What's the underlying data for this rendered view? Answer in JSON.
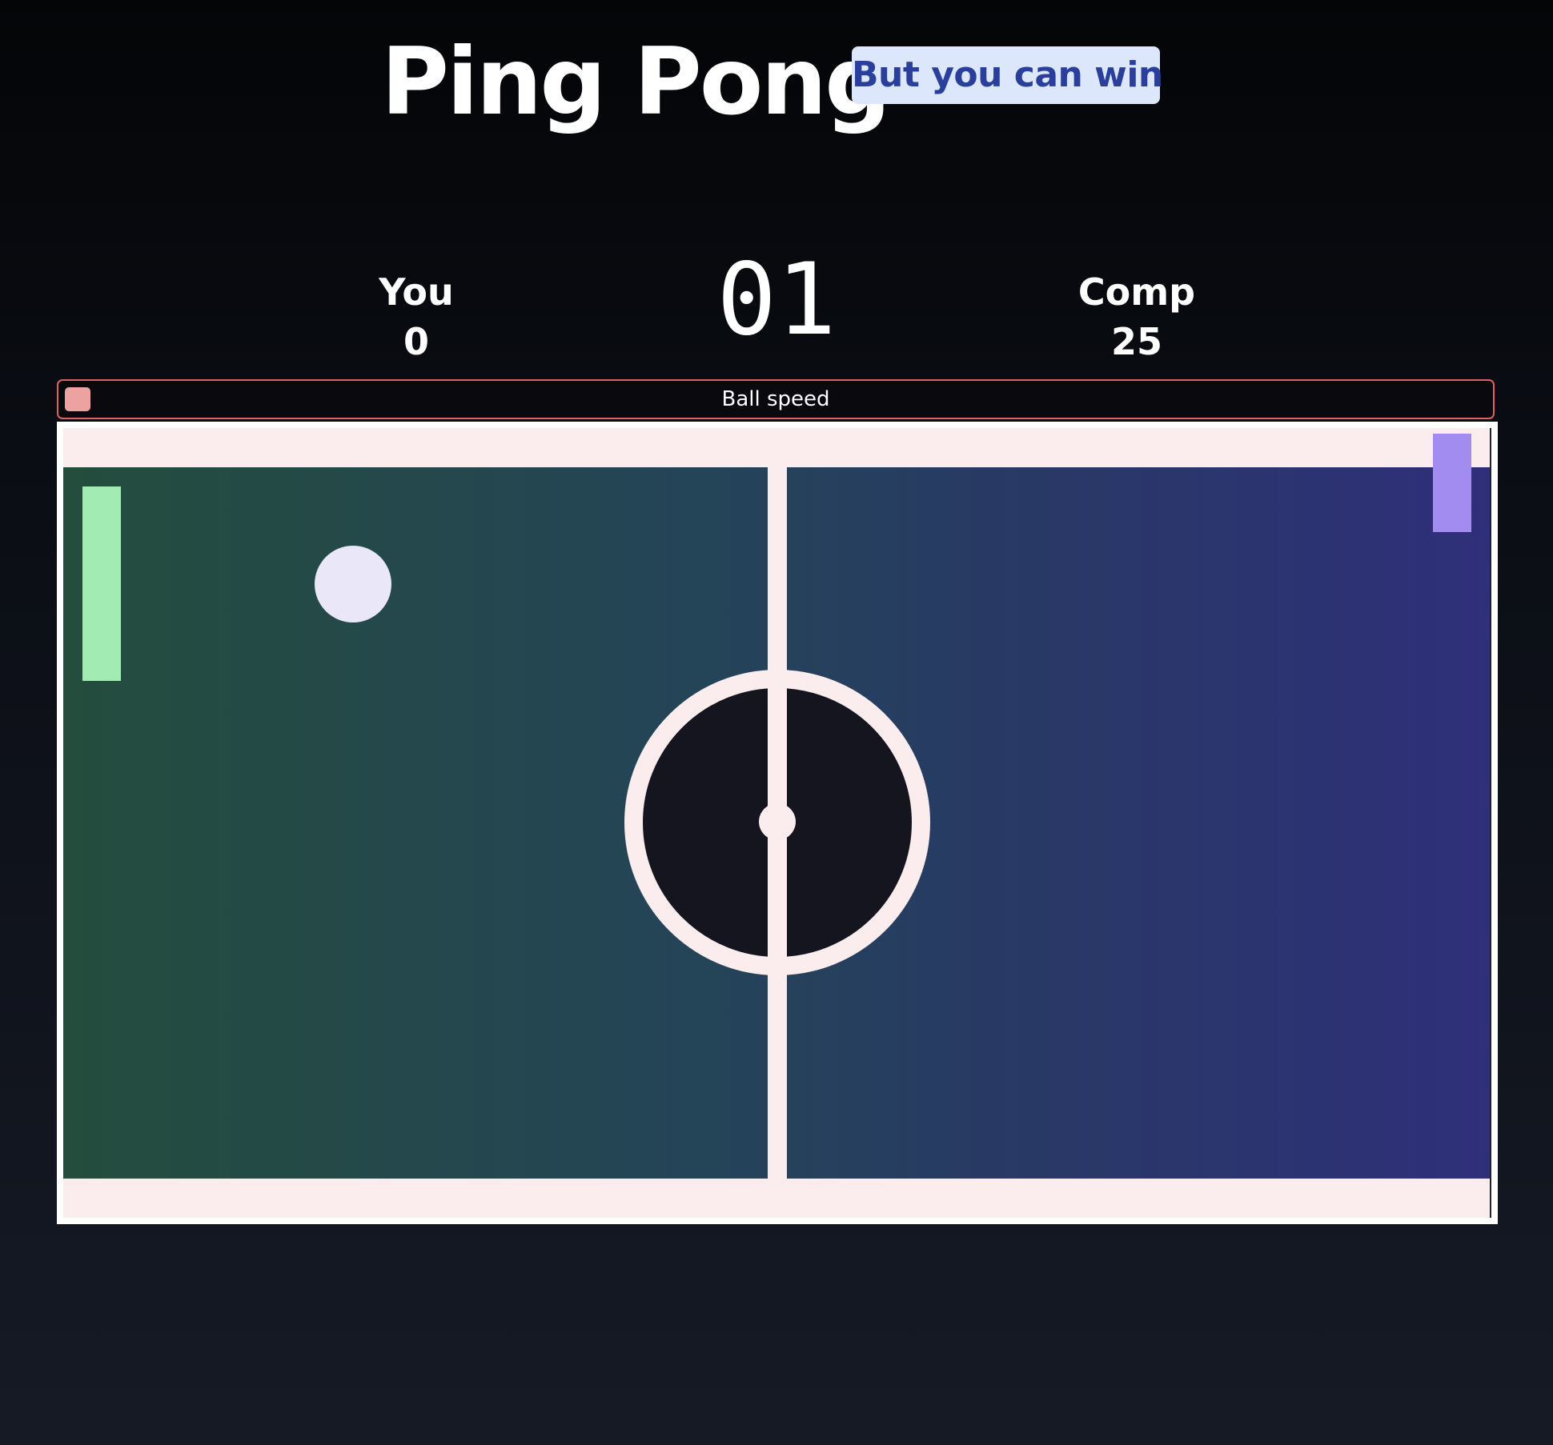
{
  "header": {
    "title": "Ping Pong",
    "badge": "But you can win"
  },
  "scoreboard": {
    "player": {
      "label": "You",
      "score": "0"
    },
    "computer": {
      "label": "Comp",
      "score": "25"
    },
    "timer": "01"
  },
  "speed": {
    "label": "Ball speed",
    "level": 0.018
  },
  "colors": {
    "player_paddle": "#a2ebb2",
    "computer_paddle": "#a28cf0",
    "ball": "#e9e7f8",
    "court_lines": "#fbeced",
    "speed_bar_border": "#d8655f",
    "speed_fill": "#eca2a1",
    "badge_bg": "#dde7fb",
    "badge_text": "#2a3f9c"
  }
}
